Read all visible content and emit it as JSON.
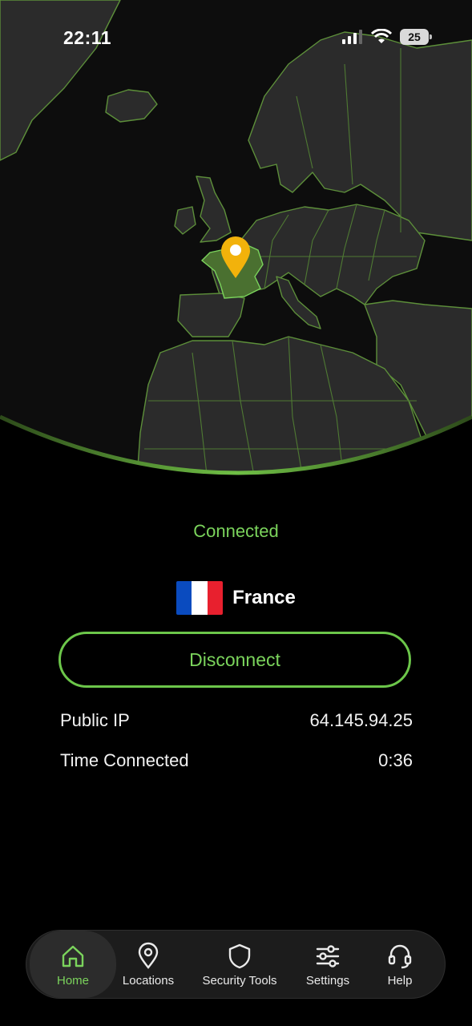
{
  "status_bar": {
    "time": "22:11",
    "battery": "25"
  },
  "map": {
    "selected_country": "France",
    "pin_color": "#f2b20b"
  },
  "connection": {
    "status": "Connected",
    "country": "France",
    "action_label": "Disconnect"
  },
  "info": [
    {
      "label": "Public IP",
      "value": "64.145.94.25"
    },
    {
      "label": "Time Connected",
      "value": "0:36"
    }
  ],
  "tabs": {
    "home": "Home",
    "locations": "Locations",
    "security": "Security Tools",
    "settings": "Settings",
    "help": "Help"
  },
  "colors": {
    "accent": "#7bd45c",
    "background": "#000000",
    "land": "#2b2b2b",
    "border": "#5d8f3a"
  }
}
